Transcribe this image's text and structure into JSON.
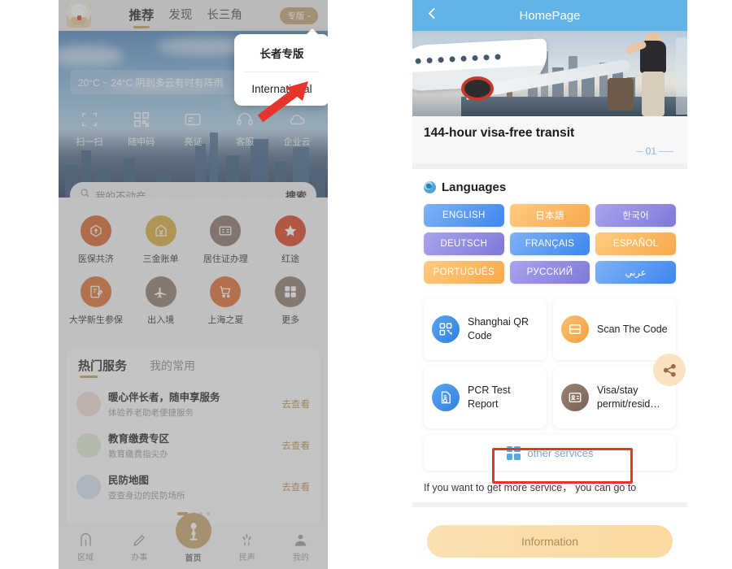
{
  "left_app": {
    "topbar": {
      "mascot_icon": "mascot-avatar-icon",
      "tabs": [
        {
          "label": "推荐",
          "active": true
        },
        {
          "label": "发现",
          "active": false
        },
        {
          "label": "长三角",
          "active": false
        }
      ],
      "version_pill": {
        "label": "专版",
        "caret": "⌄"
      }
    },
    "dropdown": {
      "items": [
        {
          "label": "长者专版"
        },
        {
          "label": "International"
        }
      ]
    },
    "hero": {
      "weather": "20°C ~ 24°C  阴到多云有时有阵雨",
      "quick_actions": [
        {
          "label": "扫一扫",
          "icon": "scan-icon"
        },
        {
          "label": "随申码",
          "icon": "qr-code-icon"
        },
        {
          "label": "亮证",
          "icon": "id-card-icon"
        },
        {
          "label": "客服",
          "icon": "headset-icon"
        },
        {
          "label": "企业云",
          "icon": "cloud-icon"
        }
      ],
      "search": {
        "placeholder": "我的不动产",
        "button": "搜索",
        "icon": "search-icon"
      }
    },
    "grid_icons": [
      {
        "label": "医保共济",
        "color": "#d9622c",
        "glyph": "⛨"
      },
      {
        "label": "三金账单",
        "color": "#d9a93a",
        "glyph": "¥"
      },
      {
        "label": "居住证办理",
        "color": "#8a7468",
        "glyph": "▤"
      },
      {
        "label": "红途",
        "color": "#d9431f",
        "glyph": "★"
      },
      {
        "label": "大学新生参保",
        "color": "#de6f31",
        "glyph": "✎"
      },
      {
        "label": "出入境",
        "color": "#8d7a6c",
        "glyph": "✈"
      },
      {
        "label": "上海之夏",
        "color": "#e06a33",
        "glyph": "🛒"
      },
      {
        "label": "更多",
        "color": "#8d7a6c",
        "glyph": "⊞"
      }
    ],
    "service_card": {
      "tabs": [
        {
          "label": "热门服务",
          "active": true
        },
        {
          "label": "我的常用",
          "active": false
        }
      ],
      "rows": [
        {
          "title": "暖心伴长者，随申享服务",
          "subtitle": "体验养老助老便捷服务",
          "action": "去查看",
          "avatar_color": "#f2d9d4"
        },
        {
          "title": "教育缴费专区",
          "subtitle": "教育缴费指尖办",
          "action": "去查看",
          "avatar_color": "#ddebd0"
        },
        {
          "title": "民防地图",
          "subtitle": "查查身边的民防场所",
          "action": "去查看",
          "avatar_color": "#d5e1f0"
        }
      ],
      "dots": 4,
      "active_dot": 0
    },
    "tabbar": [
      {
        "label": "区域",
        "icon": "arch-icon",
        "active": false
      },
      {
        "label": "办事",
        "icon": "pen-icon",
        "active": false
      },
      {
        "label": "首页",
        "icon": "pearl-tower-icon",
        "active": true
      },
      {
        "label": "民声",
        "icon": "magnolia-icon",
        "active": false
      },
      {
        "label": "我的",
        "icon": "person-icon",
        "active": false
      }
    ]
  },
  "right_app": {
    "header": {
      "title": "HomePage",
      "back_icon": "back-arrow-icon"
    },
    "banner": {
      "image_alt": "airplane-shanghai-skyline-traveler",
      "title": "144-hour visa-free transit",
      "pager": "01"
    },
    "languages_section": {
      "title": "Languages",
      "icon": "globe-icon",
      "buttons": [
        {
          "label": "ENGLISH",
          "style": "blue"
        },
        {
          "label": "日本語",
          "style": "orange"
        },
        {
          "label": "한국어",
          "style": "purple"
        },
        {
          "label": "DEUTSCH",
          "style": "purple"
        },
        {
          "label": "FRANÇAIS",
          "style": "blue"
        },
        {
          "label": "ESPAÑOL",
          "style": "orange"
        },
        {
          "label": "PORTUGUÊS",
          "style": "orange"
        },
        {
          "label": "РУССКИЙ",
          "style": "purple"
        },
        {
          "label": "عربي",
          "style": "blue"
        }
      ]
    },
    "service_cards": [
      {
        "label": "Shanghai QR Code",
        "icon": "qr-code-icon",
        "color": "#3f8fe8",
        "glyph": "▦"
      },
      {
        "label": "Scan The Code",
        "icon": "scan-barcode-icon",
        "color": "#f5ab4e",
        "glyph": "▤"
      },
      {
        "label": "PCR Test Report",
        "icon": "document-search-icon",
        "color": "#3f8fe8",
        "glyph": "🗎"
      },
      {
        "label": "Visa/stay permit/resid…",
        "icon": "id-card-icon",
        "color": "#8a7163",
        "glyph": "▣"
      }
    ],
    "share_badge": {
      "icon": "share-icon"
    },
    "other_services": {
      "label": "other services",
      "icon": "grid-icon",
      "highlight_color": "#e8352b"
    },
    "note": "If you want to get more service，  you can go to",
    "info_button": {
      "label": "Information"
    }
  }
}
